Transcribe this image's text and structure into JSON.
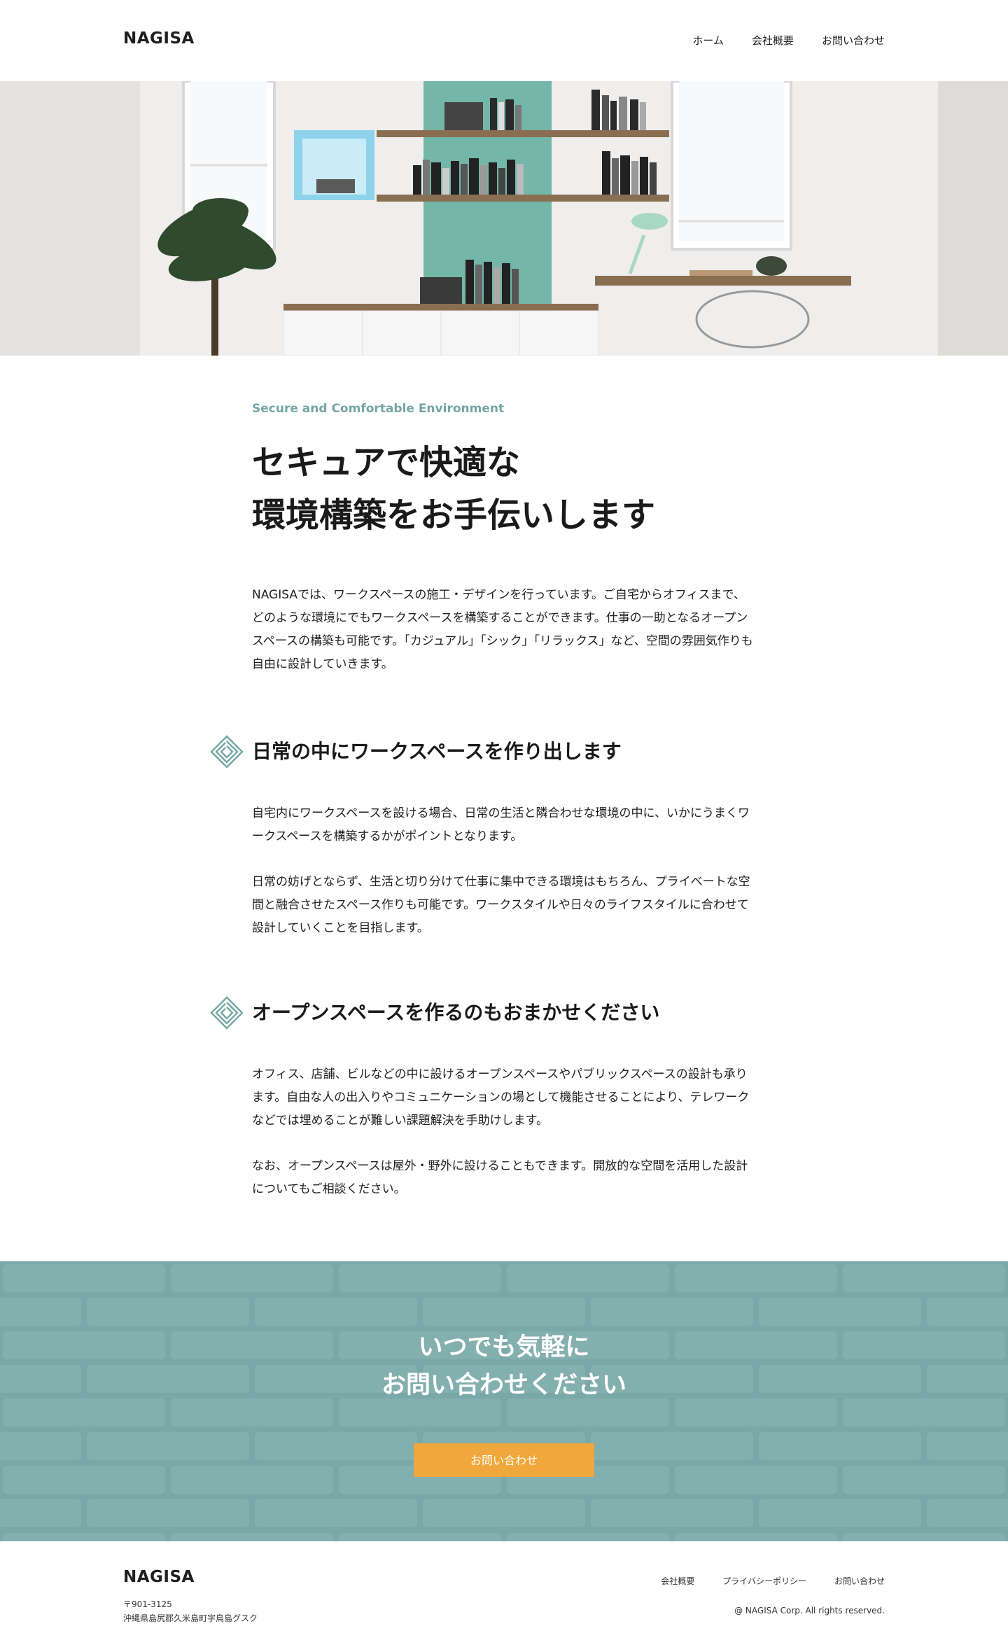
{
  "header": {
    "logo": "NAGISA",
    "nav": [
      {
        "label": "ホーム"
      },
      {
        "label": "会社概要"
      },
      {
        "label": "お問い合わせ"
      }
    ]
  },
  "intro": {
    "eyebrow": "Secure and Comfortable Environment",
    "headline_line1": "セキュアで快適な",
    "headline_line2": "環境構築をお手伝いします",
    "lead": "NAGISAでは、ワークスペースの施工・デザインを行っています。ご自宅からオフィスまで、どのような環境にでもワークスペースを構築することができます。仕事の一助となるオープンスペースの構築も可能です。「カジュアル」「シック」「リラックス」など、空間の雰囲気作りも自由に設計していきます。"
  },
  "sections": [
    {
      "title": "日常の中にワークスペースを作り出します",
      "paragraphs": [
        "自宅内にワークスペースを設ける場合、日常の生活と隣合わせな環境の中に、いかにうまくワークスペースを構築するかがポイントとなります。",
        "日常の妨げとならず、生活と切り分けて仕事に集中できる環境はもちろん、プライベートな空間と融合させたスペース作りも可能です。ワークスタイルや日々のライフスタイルに合わせて設計していくことを目指します。"
      ]
    },
    {
      "title": "オープンスペースを作るのもおまかせください",
      "paragraphs": [
        "オフィス、店舗、ビルなどの中に設けるオープンスペースやパブリックスペースの設計も承ります。自由な人の出入りやコミュニケーションの場として機能させることにより、テレワークなどでは埋めることが難しい課題解決を手助けします。",
        "なお、オープンスペースは屋外・野外に設けることもできます。開放的な空間を活用した設計についてもご相談ください。"
      ]
    }
  ],
  "contact": {
    "title_line1": "いつでも気軽に",
    "title_line2": "お問い合わせください",
    "button": "お問い合わせ"
  },
  "footer": {
    "logo": "NAGISA",
    "postal": "〒901-3125",
    "address": "沖縄県島尻郡久米島町字鳥島グスク",
    "nav": [
      {
        "label": "会社概要"
      },
      {
        "label": "プライバシーポリシー"
      },
      {
        "label": "お問い合わせ"
      }
    ],
    "copyright": "@ NAGISA Corp. All rights reserved."
  },
  "colors": {
    "accent": "#74a6a4",
    "contact_bg": "#7aa7a7",
    "button": "#f0a73b"
  }
}
